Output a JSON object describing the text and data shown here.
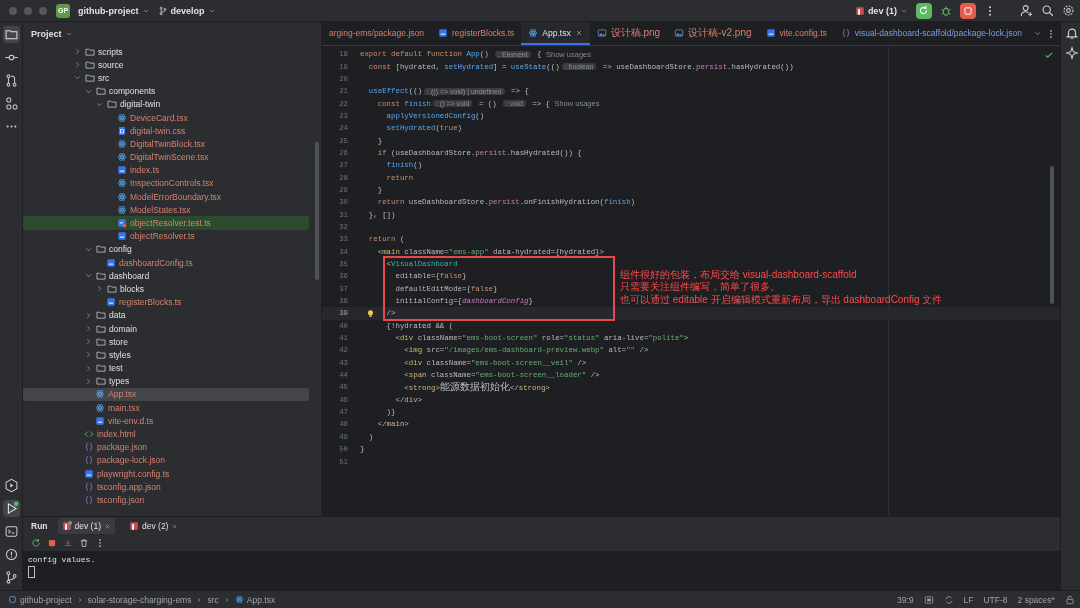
{
  "title_bar": {
    "project_badge": "GP",
    "project": "github-project",
    "branch": "develop",
    "run_config": "dev (1)"
  },
  "tool_windows_top": [
    {
      "kind": "project",
      "selected": true
    },
    {
      "kind": "commit",
      "selected": false
    },
    {
      "kind": "pull_requests",
      "selected": false
    },
    {
      "kind": "structure",
      "selected": false
    },
    {
      "kind": "more",
      "selected": false
    }
  ],
  "tool_windows_bottom": [
    {
      "kind": "services",
      "selected": false,
      "running": false
    },
    {
      "kind": "run",
      "selected": true,
      "running": true
    },
    {
      "kind": "terminal",
      "selected": false,
      "running": false
    },
    {
      "kind": "problems",
      "selected": false,
      "running": false
    },
    {
      "kind": "git",
      "selected": false,
      "running": false
    }
  ],
  "project_panel": {
    "title": "Project",
    "tree": [
      {
        "name": "scripts",
        "kind": "folder",
        "expanded": false,
        "selected": false,
        "highlighted": false
      },
      {
        "name": "source",
        "kind": "folder",
        "expanded": false,
        "selected": false,
        "highlighted": false
      },
      {
        "name": "src",
        "kind": "folder",
        "expanded": true,
        "selected": false,
        "highlighted": false,
        "children": [
          {
            "name": "components",
            "kind": "folder",
            "expanded": true,
            "selected": false,
            "highlighted": false,
            "children": [
              {
                "name": "digital-twin",
                "kind": "folder",
                "expanded": true,
                "selected": false,
                "highlighted": false,
                "children": [
                  {
                    "name": "DeviceCard.tsx",
                    "kind": "tsx",
                    "selected": false,
                    "highlighted": false
                  },
                  {
                    "name": "digital-twin.css",
                    "kind": "css",
                    "selected": false,
                    "highlighted": false
                  },
                  {
                    "name": "DigitalTwinBlock.tsx",
                    "kind": "tsx",
                    "selected": false,
                    "highlighted": false
                  },
                  {
                    "name": "DigitalTwinScene.tsx",
                    "kind": "tsx",
                    "selected": false,
                    "highlighted": false
                  },
                  {
                    "name": "index.ts",
                    "kind": "ts",
                    "selected": false,
                    "highlighted": false
                  },
                  {
                    "name": "InspectionControls.tsx",
                    "kind": "tsx",
                    "selected": false,
                    "highlighted": false
                  },
                  {
                    "name": "ModelErrorBoundary.tsx",
                    "kind": "tsx",
                    "selected": false,
                    "highlighted": false
                  },
                  {
                    "name": "ModelStates.tsx",
                    "kind": "tsx",
                    "selected": false,
                    "highlighted": false
                  },
                  {
                    "name": "objectResolver.test.ts",
                    "kind": "test",
                    "selected": false,
                    "highlighted": true
                  },
                  {
                    "name": "objectResolver.ts",
                    "kind": "ts",
                    "selected": false,
                    "highlighted": false
                  }
                ]
              }
            ]
          },
          {
            "name": "config",
            "kind": "folder",
            "expanded": true,
            "selected": false,
            "highlighted": false,
            "children": [
              {
                "name": "dashboardConfig.ts",
                "kind": "ts",
                "selected": false,
                "highlighted": false
              }
            ]
          },
          {
            "name": "dashboard",
            "kind": "folder",
            "expanded": true,
            "selected": false,
            "highlighted": false,
            "children": [
              {
                "name": "blocks",
                "kind": "folder",
                "expanded": false,
                "selected": false,
                "highlighted": false
              },
              {
                "name": "registerBlocks.ts",
                "kind": "ts",
                "selected": false,
                "highlighted": false
              }
            ]
          },
          {
            "name": "data",
            "kind": "folder",
            "expanded": false,
            "selected": false,
            "highlighted": false
          },
          {
            "name": "domain",
            "kind": "folder",
            "expanded": false,
            "selected": false,
            "highlighted": false
          },
          {
            "name": "store",
            "kind": "folder",
            "expanded": false,
            "selected": false,
            "highlighted": false
          },
          {
            "name": "styles",
            "kind": "folder",
            "expanded": false,
            "selected": false,
            "highlighted": false
          },
          {
            "name": "test",
            "kind": "folder",
            "expanded": false,
            "selected": false,
            "highlighted": false
          },
          {
            "name": "types",
            "kind": "folder",
            "expanded": false,
            "selected": false,
            "highlighted": false
          },
          {
            "name": "App.tsx",
            "kind": "tsx",
            "selected": true,
            "highlighted": false
          },
          {
            "name": "main.tsx",
            "kind": "tsx",
            "selected": false,
            "highlighted": false
          },
          {
            "name": "vite-env.d.ts",
            "kind": "ts",
            "selected": false,
            "highlighted": false
          }
        ]
      },
      {
        "name": "index.html",
        "kind": "html",
        "selected": false,
        "highlighted": false
      },
      {
        "name": "package.json",
        "kind": "json",
        "selected": false,
        "highlighted": false
      },
      {
        "name": "package-lock.json",
        "kind": "json",
        "selected": false,
        "highlighted": false
      },
      {
        "name": "playwright.config.ts",
        "kind": "ts",
        "selected": false,
        "highlighted": false
      },
      {
        "name": "tsconfig.app.json",
        "kind": "json",
        "selected": false,
        "highlighted": false
      },
      {
        "name": "tsconfig.json",
        "kind": "json",
        "selected": false,
        "highlighted": false
      }
    ]
  },
  "tabs": [
    {
      "label": "arging-ems/package.json",
      "kind": "none",
      "modified": true,
      "external": false,
      "selected": false
    },
    {
      "label": "registerBlocks.ts",
      "kind": "ts",
      "modified": true,
      "external": false,
      "selected": false
    },
    {
      "label": "App.tsx",
      "kind": "tsx",
      "modified": false,
      "external": false,
      "selected": true
    },
    {
      "label": "设计稿.png",
      "kind": "image",
      "modified": true,
      "external": false,
      "selected": false
    },
    {
      "label": "设计稿-v2.png",
      "kind": "image",
      "modified": true,
      "external": false,
      "selected": false
    },
    {
      "label": "vite.config.ts",
      "kind": "ts",
      "modified": true,
      "external": false,
      "selected": false
    },
    {
      "label": "visual-dashboard-scaffold/package-lock.json",
      "kind": "json",
      "modified": false,
      "external": true,
      "selected": false
    }
  ],
  "editor": {
    "lines": [
      {
        "n": "18",
        "current": false,
        "bulb": false,
        "tokens": [
          {
            "kind": "keyword",
            "t": "export default function "
          },
          {
            "kind": "function",
            "t": "App"
          },
          {
            "kind": "plain",
            "t": "() "
          },
          {
            "kind": "hint",
            "t": ": Element"
          },
          {
            "kind": "plain",
            "t": " { "
          },
          {
            "kind": "usage",
            "t": "Show usages"
          }
        ]
      },
      {
        "n": "19",
        "current": false,
        "bulb": false,
        "tokens": [
          {
            "kind": "keyword",
            "t": "  const "
          },
          {
            "kind": "plain",
            "t": "[hydrated, "
          },
          {
            "kind": "function",
            "t": "setHydrated"
          },
          {
            "kind": "plain",
            "t": "] = "
          },
          {
            "kind": "function",
            "t": "useState"
          },
          {
            "kind": "plain",
            "t": "(()"
          },
          {
            "kind": "hint",
            "t": ": boolean"
          },
          {
            "kind": "plain",
            "t": " => useDashboardStore."
          },
          {
            "kind": "property",
            "t": "persist"
          },
          {
            "kind": "plain",
            "t": ".hasHydrated())"
          }
        ]
      },
      {
        "n": "20",
        "current": false,
        "bulb": false
      },
      {
        "n": "21",
        "current": false,
        "bulb": false,
        "tokens": [
          {
            "kind": "function",
            "t": "  useEffect"
          },
          {
            "kind": "plain",
            "t": "(()"
          },
          {
            "kind": "hint",
            "t": ": (() => void) | undefined"
          },
          {
            "kind": "plain",
            "t": " => {"
          }
        ]
      },
      {
        "n": "22",
        "current": false,
        "bulb": false,
        "tokens": [
          {
            "kind": "keyword",
            "t": "    const "
          },
          {
            "kind": "function",
            "t": "finish"
          },
          {
            "kind": "hint",
            "t": ": () => void"
          },
          {
            "kind": "plain",
            "t": " = () "
          },
          {
            "kind": "hint",
            "t": ": void"
          },
          {
            "kind": "plain",
            "t": " => { "
          },
          {
            "kind": "usage",
            "t": "Show usages"
          }
        ]
      },
      {
        "n": "23",
        "current": false,
        "bulb": false,
        "tokens": [
          {
            "kind": "function",
            "t": "      applyVersionedConfig"
          },
          {
            "kind": "plain",
            "t": "()"
          }
        ]
      },
      {
        "n": "24",
        "current": false,
        "bulb": false,
        "tokens": [
          {
            "kind": "function",
            "t": "      setHydrated"
          },
          {
            "kind": "plain",
            "t": "("
          },
          {
            "kind": "keyword",
            "t": "true"
          },
          {
            "kind": "plain",
            "t": ")"
          }
        ]
      },
      {
        "n": "25",
        "current": false,
        "bulb": false,
        "tokens": [
          {
            "kind": "plain",
            "t": "    }"
          }
        ]
      },
      {
        "n": "26",
        "current": false,
        "bulb": false,
        "tokens": [
          {
            "kind": "keyword",
            "t": "    if "
          },
          {
            "kind": "plain",
            "t": "(useDashboardStore."
          },
          {
            "kind": "property",
            "t": "persist"
          },
          {
            "kind": "plain",
            "t": ".hasHydrated()) {"
          }
        ]
      },
      {
        "n": "27",
        "current": false,
        "bulb": false,
        "tokens": [
          {
            "kind": "function",
            "t": "      finish"
          },
          {
            "kind": "plain",
            "t": "()"
          }
        ]
      },
      {
        "n": "28",
        "current": false,
        "bulb": false,
        "tokens": [
          {
            "kind": "keyword",
            "t": "      return"
          }
        ]
      },
      {
        "n": "29",
        "current": false,
        "bulb": false,
        "tokens": [
          {
            "kind": "plain",
            "t": "    }"
          }
        ]
      },
      {
        "n": "30",
        "current": false,
        "bulb": false,
        "tokens": [
          {
            "kind": "keyword",
            "t": "    return "
          },
          {
            "kind": "plain",
            "t": "useDashboardStore."
          },
          {
            "kind": "property",
            "t": "persist"
          },
          {
            "kind": "plain",
            "t": ".onFinishHydration("
          },
          {
            "kind": "function",
            "t": "finish"
          },
          {
            "kind": "plain",
            "t": ")"
          }
        ]
      },
      {
        "n": "31",
        "current": false,
        "bulb": false,
        "tokens": [
          {
            "kind": "plain",
            "t": "  }, [])"
          }
        ]
      },
      {
        "n": "32",
        "current": false,
        "bulb": false
      },
      {
        "n": "33",
        "current": false,
        "bulb": false,
        "tokens": [
          {
            "kind": "keyword",
            "t": "  return "
          },
          {
            "kind": "plain",
            "t": "("
          }
        ]
      },
      {
        "n": "34",
        "current": false,
        "bulb": false,
        "tokens": [
          {
            "kind": "plain",
            "t": "    <"
          },
          {
            "kind": "tag",
            "t": "main"
          },
          {
            "kind": "attribute",
            "t": " className"
          },
          {
            "kind": "plain",
            "t": "="
          },
          {
            "kind": "string",
            "t": "\"ems-app\""
          },
          {
            "kind": "attribute",
            "t": " data-hydrated"
          },
          {
            "kind": "plain",
            "t": "={hydrated}>"
          }
        ]
      },
      {
        "n": "35",
        "current": false,
        "bulb": false,
        "tokens": [
          {
            "kind": "plain",
            "t": "      <"
          },
          {
            "kind": "component",
            "t": "VisualDashboard"
          }
        ]
      },
      {
        "n": "36",
        "current": false,
        "bulb": false,
        "tokens": [
          {
            "kind": "attribute",
            "t": "        editable"
          },
          {
            "kind": "plain",
            "t": "={"
          },
          {
            "kind": "keyword",
            "t": "false"
          },
          {
            "kind": "plain",
            "t": "}"
          }
        ]
      },
      {
        "n": "37",
        "current": false,
        "bulb": false,
        "tokens": [
          {
            "kind": "attribute",
            "t": "        defaultEditMode"
          },
          {
            "kind": "plain",
            "t": "={"
          },
          {
            "kind": "keyword",
            "t": "false"
          },
          {
            "kind": "plain",
            "t": "}"
          }
        ]
      },
      {
        "n": "38",
        "current": false,
        "bulb": false,
        "tokens": [
          {
            "kind": "attribute",
            "t": "        initialConfig"
          },
          {
            "kind": "plain",
            "t": "={"
          },
          {
            "kind": "variable",
            "t": "dashboardConfig"
          },
          {
            "kind": "plain",
            "t": "}"
          }
        ]
      },
      {
        "n": "39",
        "current": true,
        "bulb": true,
        "tokens": [
          {
            "kind": "plain",
            "t": "      />"
          }
        ]
      },
      {
        "n": "40",
        "current": false,
        "bulb": false,
        "tokens": [
          {
            "kind": "plain",
            "t": "      {!hydrated && ("
          }
        ]
      },
      {
        "n": "41",
        "current": false,
        "bulb": false,
        "tokens": [
          {
            "kind": "plain",
            "t": "        <"
          },
          {
            "kind": "tag",
            "t": "div"
          },
          {
            "kind": "attribute",
            "t": " className"
          },
          {
            "kind": "plain",
            "t": "="
          },
          {
            "kind": "string",
            "t": "\"ems-boot-screen\""
          },
          {
            "kind": "attribute",
            "t": " role"
          },
          {
            "kind": "plain",
            "t": "="
          },
          {
            "kind": "string",
            "t": "\"status\""
          },
          {
            "kind": "attribute",
            "t": " aria-live"
          },
          {
            "kind": "plain",
            "t": "="
          },
          {
            "kind": "string",
            "t": "\"polite\""
          },
          {
            "kind": "plain",
            "t": ">"
          }
        ]
      },
      {
        "n": "42",
        "current": false,
        "bulb": false,
        "tokens": [
          {
            "kind": "plain",
            "t": "          <"
          },
          {
            "kind": "tag",
            "t": "img"
          },
          {
            "kind": "attribute",
            "t": " src"
          },
          {
            "kind": "plain",
            "t": "="
          },
          {
            "kind": "string",
            "t": "\"/images/ems-dashboard-preview.webp\""
          },
          {
            "kind": "attribute",
            "t": " alt"
          },
          {
            "kind": "plain",
            "t": "="
          },
          {
            "kind": "string",
            "t": "\"\""
          },
          {
            "kind": "plain",
            "t": " />"
          }
        ]
      },
      {
        "n": "43",
        "current": false,
        "bulb": false,
        "tokens": [
          {
            "kind": "plain",
            "t": "          <"
          },
          {
            "kind": "tag",
            "t": "div"
          },
          {
            "kind": "attribute",
            "t": " className"
          },
          {
            "kind": "plain",
            "t": "="
          },
          {
            "kind": "string",
            "t": "\"ems-boot-screen__veil\""
          },
          {
            "kind": "plain",
            "t": " />"
          }
        ]
      },
      {
        "n": "44",
        "current": false,
        "bulb": false,
        "tokens": [
          {
            "kind": "plain",
            "t": "          <"
          },
          {
            "kind": "tag",
            "t": "span"
          },
          {
            "kind": "attribute",
            "t": " className"
          },
          {
            "kind": "plain",
            "t": "="
          },
          {
            "kind": "string",
            "t": "\"ems-boot-screen__loader\""
          },
          {
            "kind": "plain",
            "t": " />"
          }
        ]
      },
      {
        "n": "45",
        "current": false,
        "bulb": false,
        "tokens": [
          {
            "kind": "plain",
            "t": "          <"
          },
          {
            "kind": "tag",
            "t": "strong"
          },
          {
            "kind": "plain",
            "t": ">"
          },
          {
            "kind": "text",
            "t": "能源数据初始化"
          },
          {
            "kind": "plain",
            "t": "</"
          },
          {
            "kind": "tag",
            "t": "strong"
          },
          {
            "kind": "plain",
            "t": ">"
          }
        ]
      },
      {
        "n": "46",
        "current": false,
        "bulb": false,
        "tokens": [
          {
            "kind": "plain",
            "t": "        </"
          },
          {
            "kind": "tag",
            "t": "div"
          },
          {
            "kind": "plain",
            "t": ">"
          }
        ]
      },
      {
        "n": "47",
        "current": false,
        "bulb": false,
        "tokens": [
          {
            "kind": "plain",
            "t": "      )}"
          }
        ]
      },
      {
        "n": "48",
        "current": false,
        "bulb": false,
        "tokens": [
          {
            "kind": "plain",
            "t": "    </"
          },
          {
            "kind": "tag",
            "t": "main"
          },
          {
            "kind": "plain",
            "t": ">"
          }
        ]
      },
      {
        "n": "49",
        "current": false,
        "bulb": false,
        "tokens": [
          {
            "kind": "plain",
            "t": "  )"
          }
        ]
      },
      {
        "n": "50",
        "current": false,
        "bulb": false,
        "tokens": [
          {
            "kind": "plain",
            "t": "}"
          }
        ]
      },
      {
        "n": "51",
        "current": false,
        "bulb": false
      }
    ],
    "annotation": [
      "组件很好的包装，布局交给 visual-dashboard-scaffold",
      "只需要关注组件编写，简单了很多。",
      "也可以通过 editable 开启编辑模式重新布局，导出 dashboardConfig 文件"
    ]
  },
  "run_panel": {
    "title": "Run",
    "tabs": [
      {
        "label": "dev (1)",
        "selected": true,
        "running": true
      },
      {
        "label": "dev (2)",
        "selected": false,
        "running": false
      }
    ],
    "console": [
      "config values."
    ]
  },
  "status_bar": {
    "breadcrumbs": [
      {
        "label": "github-project",
        "kind": "module"
      },
      {
        "label": "solar-storage-charging-ems",
        "kind": "none"
      },
      {
        "label": "src",
        "kind": "none"
      },
      {
        "label": "App.tsx",
        "kind": "tsx"
      }
    ],
    "position": "39:9",
    "line_ending": "LF",
    "encoding": "UTF-8",
    "indent": "2 spaces*"
  }
}
